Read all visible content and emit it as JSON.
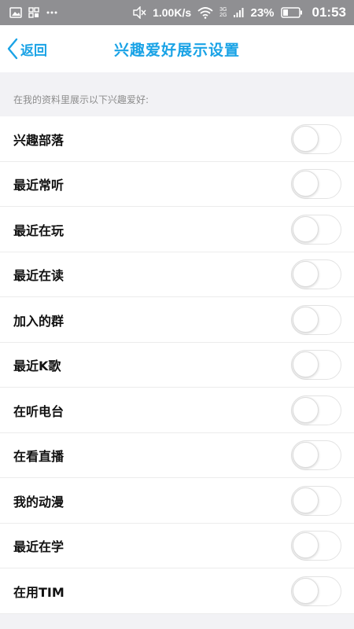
{
  "status_bar": {
    "network_speed": "1.00K/s",
    "network_type_top": "3G",
    "network_type_bottom": "2G",
    "battery_percent": "23%",
    "time": "01:53"
  },
  "nav": {
    "back_label": "返回",
    "title": "兴趣爱好展示设置"
  },
  "section": {
    "header": "在我的资料里展示以下兴趣爱好:"
  },
  "colors": {
    "accent": "#1aa3e6",
    "status_bar": "#8f8f92"
  },
  "items": [
    {
      "label": "兴趣部落",
      "enabled": false
    },
    {
      "label": "最近常听",
      "enabled": false
    },
    {
      "label": "最近在玩",
      "enabled": false
    },
    {
      "label": "最近在读",
      "enabled": false
    },
    {
      "label": "加入的群",
      "enabled": false
    },
    {
      "label": "最近K歌",
      "enabled": false
    },
    {
      "label": "在听电台",
      "enabled": false
    },
    {
      "label": "在看直播",
      "enabled": false
    },
    {
      "label": "我的动漫",
      "enabled": false
    },
    {
      "label": "最近在学",
      "enabled": false
    },
    {
      "label": "在用TIM",
      "enabled": false
    }
  ]
}
